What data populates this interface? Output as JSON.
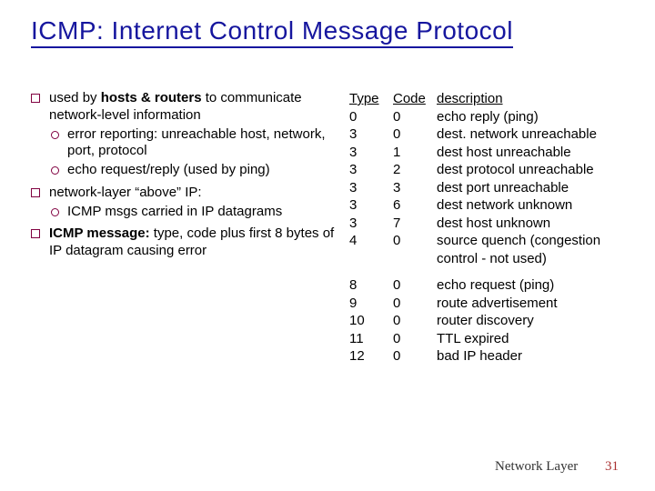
{
  "title": "ICMP: Internet Control Message Protocol",
  "left": {
    "items": [
      {
        "text_a": "used by ",
        "bold": "hosts & routers",
        "text_b": " to communicate network-level information",
        "sub": [
          "error reporting: unreachable host, network, port, protocol",
          "echo request/reply (used by ping)"
        ]
      },
      {
        "text_a": "network-layer “above” IP:",
        "bold": "",
        "text_b": "",
        "sub": [
          "ICMP msgs carried in IP datagrams"
        ]
      },
      {
        "text_a": "",
        "bold": "ICMP message:",
        "text_b": " type, code plus first 8 bytes of IP datagram causing error",
        "sub": []
      }
    ]
  },
  "table": {
    "headers": {
      "a": "Type",
      "b": "Code",
      "c": "description"
    },
    "rows1": [
      {
        "a": "0",
        "b": "0",
        "c": "echo reply (ping)"
      },
      {
        "a": "3",
        "b": "0",
        "c": "dest. network unreachable"
      },
      {
        "a": "3",
        "b": "1",
        "c": "dest host unreachable"
      },
      {
        "a": "3",
        "b": "2",
        "c": "dest protocol unreachable"
      },
      {
        "a": "3",
        "b": "3",
        "c": "dest port unreachable"
      },
      {
        "a": "3",
        "b": "6",
        "c": "dest network unknown"
      },
      {
        "a": "3",
        "b": "7",
        "c": "dest host unknown"
      },
      {
        "a": "4",
        "b": "0",
        "c": "source quench (congestion control - not used)"
      }
    ],
    "rows2": [
      {
        "a": "8",
        "b": "0",
        "c": "echo request (ping)"
      },
      {
        "a": "9",
        "b": "0",
        "c": "route advertisement"
      },
      {
        "a": "10",
        "b": "0",
        "c": "router discovery"
      },
      {
        "a": "11",
        "b": "0",
        "c": "TTL expired"
      },
      {
        "a": "12",
        "b": "0",
        "c": "bad IP header"
      }
    ]
  },
  "footer": {
    "label": "Network Layer",
    "page": "31"
  }
}
